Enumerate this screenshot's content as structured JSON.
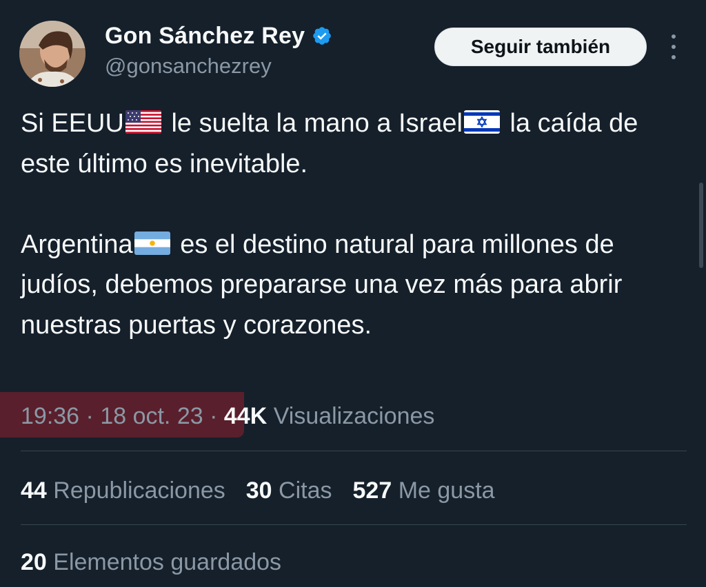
{
  "author": {
    "display_name": "Gon Sánchez Rey",
    "handle": "@gonsanchezrey",
    "verified_icon": "verified-badge-icon",
    "avatar_icon": "avatar-photo"
  },
  "follow_button": {
    "label": "Seguir también"
  },
  "more_button": {
    "icon": "more-vertical-icon"
  },
  "tweet": {
    "p1_a": "Si EEUU",
    "p1_b": " le suelta la mano a Israel",
    "p1_c": " la caída de este último es inevitable.",
    "p2_a": "Argentina",
    "p2_b": " es el destino natural para millones de judíos, debemos prepararse una vez más para abrir nuestras puertas y corazones.",
    "flags": [
      "flag-usa-icon",
      "flag-israel-icon",
      "flag-argentina-icon"
    ]
  },
  "meta": {
    "time": "19:36",
    "sep1": " · ",
    "date": "18 oct. 23",
    "sep2": " · ",
    "views_count": "44K",
    "views_label": " Visualizaciones"
  },
  "stats": [
    {
      "count": "44",
      "label": " Republicaciones"
    },
    {
      "count": "30",
      "label": " Citas"
    },
    {
      "count": "527",
      "label": " Me gusta"
    }
  ],
  "saved": {
    "count": "20",
    "label": " Elementos guardados"
  },
  "colors": {
    "background": "#15202b",
    "text_primary": "#f7f9f9",
    "text_secondary": "#8b98a5",
    "verified_blue": "#1d9bf0",
    "divider": "#38444d",
    "redaction": "#5a1f2c"
  }
}
